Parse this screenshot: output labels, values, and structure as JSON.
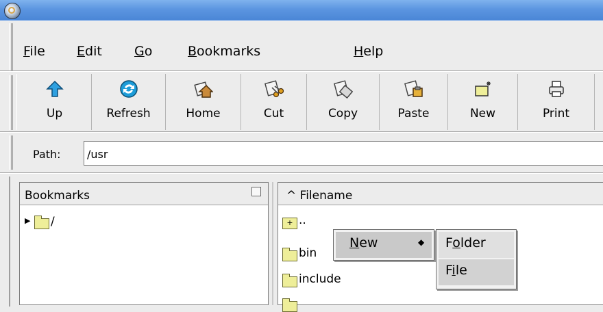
{
  "menubar": {
    "items": [
      {
        "key": "F",
        "rest": "ile"
      },
      {
        "key": "E",
        "rest": "dit"
      },
      {
        "key": "G",
        "rest": "o"
      },
      {
        "key": "B",
        "rest": "ookmarks"
      },
      {
        "key": "H",
        "rest": "elp"
      }
    ]
  },
  "toolbar": {
    "buttons": [
      {
        "label": "Up",
        "icon": "up-arrow-icon"
      },
      {
        "label": "Refresh",
        "icon": "refresh-icon"
      },
      {
        "label": "Home",
        "icon": "home-icon"
      },
      {
        "label": "Cut",
        "icon": "cut-icon"
      },
      {
        "label": "Copy",
        "icon": "copy-icon"
      },
      {
        "label": "Paste",
        "icon": "paste-icon"
      },
      {
        "label": "New",
        "icon": "new-folder-icon"
      },
      {
        "label": "Print",
        "icon": "print-icon"
      }
    ]
  },
  "pathbar": {
    "label": "Path:",
    "value": "/usr"
  },
  "bookmarks": {
    "title": "Bookmarks",
    "tree": [
      {
        "label": "/"
      }
    ]
  },
  "files": {
    "column": "^ Filename",
    "rows": [
      {
        "label": ".."
      },
      {
        "label": "bin"
      },
      {
        "label": "include"
      }
    ]
  },
  "context_menu": {
    "item": {
      "key": "N",
      "rest": "ew",
      "arrow": "◆"
    },
    "submenu": [
      {
        "pre": "F",
        "key": "o",
        "rest": "lder"
      },
      {
        "pre": "F",
        "key": "i",
        "rest": "le"
      }
    ]
  },
  "colors": {
    "titlebar": "#5b95e0",
    "highlight": "#c9c9c9"
  }
}
